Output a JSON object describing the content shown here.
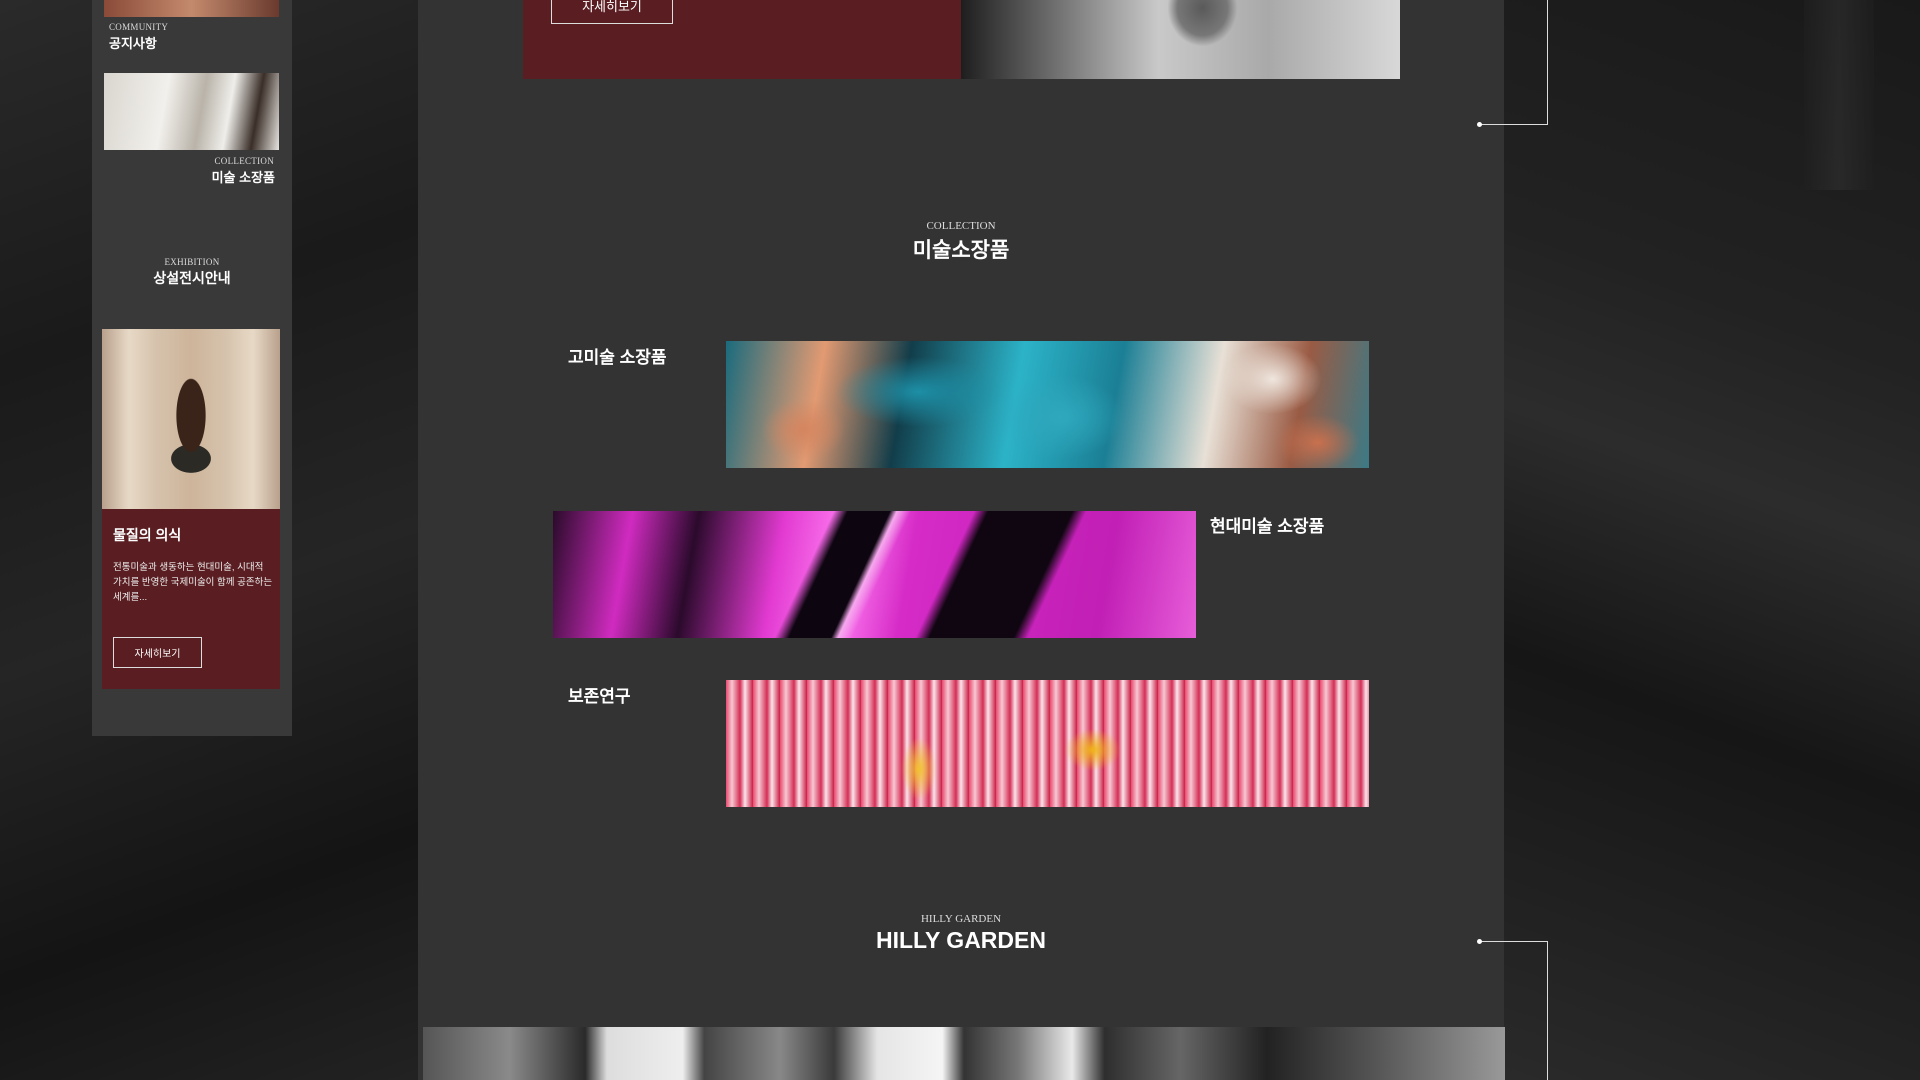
{
  "sidebar": {
    "items": [
      {
        "caption": "COMMUNITY",
        "title": "공지사항"
      },
      {
        "caption": "COLLECTION",
        "title": "미술 소장품"
      },
      {
        "caption": "EXHIBITION",
        "title": "상설전시안내"
      }
    ],
    "feature": {
      "title": "물질의 의식",
      "description": "전통미술과 생동하는 현대미술, 시대적 가치를 반영한 국제미술이 함께 공존하는 세계를...",
      "button_label": "자세히보기"
    }
  },
  "top_banner": {
    "button_label": "자세히보기"
  },
  "collection_section": {
    "caption": "COLLECTION",
    "title": "미술소장품",
    "items": [
      {
        "label": "고미술 소장품"
      },
      {
        "label": "현대미술 소장품"
      },
      {
        "label": "보존연구"
      }
    ]
  },
  "garden_section": {
    "caption": "HILLY GARDEN",
    "title": "HILLY GARDEN"
  },
  "colors": {
    "page_background": "#1c1c1c",
    "main_panel": "#333333",
    "sidebar_panel": "#393939",
    "accent_burgundy": "#5a1e22",
    "text": "#ffffff"
  }
}
